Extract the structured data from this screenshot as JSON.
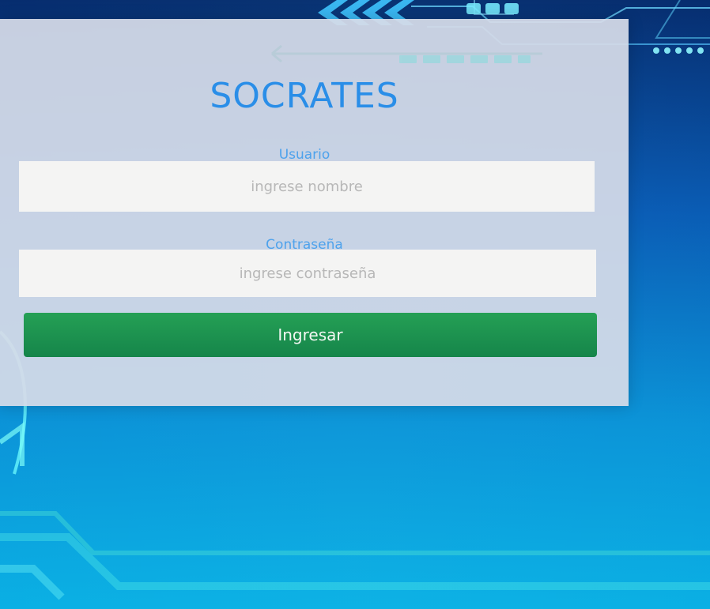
{
  "app": {
    "title": "SOCRATES"
  },
  "form": {
    "username_label": "Usuario",
    "username_placeholder": "ingrese nombre",
    "username_value": "",
    "password_label": "Contraseña",
    "password_placeholder": "ingrese contraseña",
    "password_value": "",
    "submit_label": "Ingresar"
  },
  "theme": {
    "title_color": "#2a8ee8",
    "label_color": "#4ea2ec",
    "button_color": "#1b9150",
    "panel_color": "#d6dce8"
  },
  "icons": [
    "left-arrow-icon",
    "double-chevron-icon",
    "circuit-decor-icon"
  ]
}
